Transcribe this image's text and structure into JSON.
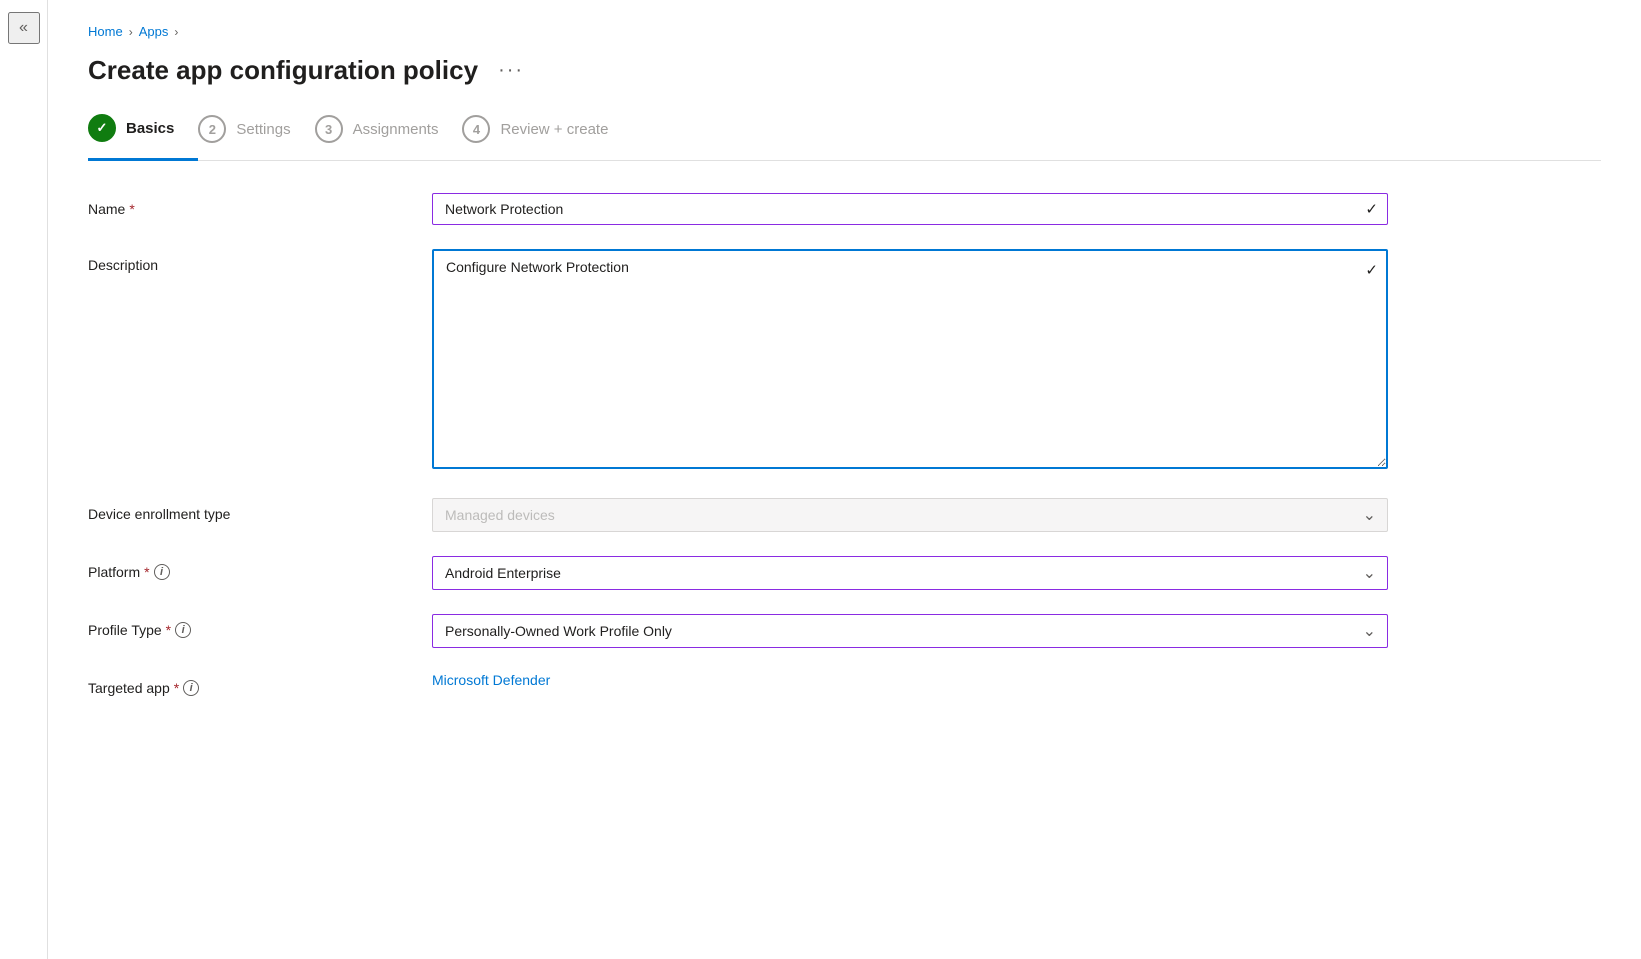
{
  "breadcrumb": {
    "home": "Home",
    "apps": "Apps",
    "sep1": ">",
    "sep2": ">"
  },
  "page": {
    "title": "Create app configuration policy",
    "more_options_label": "···"
  },
  "wizard": {
    "steps": [
      {
        "id": "basics",
        "label": "Basics",
        "number": "✓",
        "state": "completed-active"
      },
      {
        "id": "settings",
        "label": "Settings",
        "number": "2",
        "state": "inactive"
      },
      {
        "id": "assignments",
        "label": "Assignments",
        "number": "3",
        "state": "inactive"
      },
      {
        "id": "review",
        "label": "Review + create",
        "number": "4",
        "state": "inactive"
      }
    ]
  },
  "form": {
    "name_label": "Name",
    "name_value": "Network Protection",
    "description_label": "Description",
    "description_value": "Configure Network Protection",
    "device_enrollment_label": "Device enrollment type",
    "device_enrollment_value": "Managed devices",
    "platform_label": "Platform",
    "platform_value": "Android Enterprise",
    "profile_type_label": "Profile Type",
    "profile_type_value": "Personally-Owned Work Profile Only",
    "targeted_app_label": "Targeted app",
    "targeted_app_value": "Microsoft Defender"
  },
  "icons": {
    "collapse": "«",
    "checkmark": "✓",
    "dropdown_arrow": "⌄",
    "info": "i"
  }
}
